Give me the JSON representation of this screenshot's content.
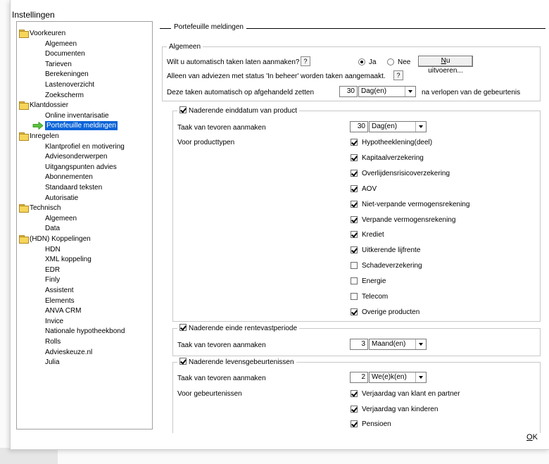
{
  "window": {
    "title": "Instellingen"
  },
  "tree": [
    {
      "label": "Voorkeuren",
      "level": 0,
      "folder": true
    },
    {
      "label": "Algemeen",
      "level": 1
    },
    {
      "label": "Documenten",
      "level": 1
    },
    {
      "label": "Tarieven",
      "level": 1
    },
    {
      "label": "Berekeningen",
      "level": 1
    },
    {
      "label": "Lastenoverzicht",
      "level": 1
    },
    {
      "label": "Zoekscherm",
      "level": 1
    },
    {
      "label": "Klantdossier",
      "level": 0,
      "folder": true
    },
    {
      "label": "Online inventarisatie",
      "level": 1
    },
    {
      "label": "Portefeuille meldingen",
      "level": 1,
      "selected": true
    },
    {
      "label": "Inregelen",
      "level": 0,
      "folder": true
    },
    {
      "label": "Klantprofiel en motivering",
      "level": 1
    },
    {
      "label": "Adviesonderwerpen",
      "level": 1
    },
    {
      "label": "Uitgangspunten advies",
      "level": 1
    },
    {
      "label": "Abonnementen",
      "level": 1
    },
    {
      "label": "Standaard teksten",
      "level": 1
    },
    {
      "label": "Autorisatie",
      "level": 1
    },
    {
      "label": "Technisch",
      "level": 0,
      "folder": true
    },
    {
      "label": "Algemeen",
      "level": 1
    },
    {
      "label": "Data",
      "level": 1
    },
    {
      "label": "(HDN) Koppelingen",
      "level": 0,
      "folder": true
    },
    {
      "label": "HDN",
      "level": 1
    },
    {
      "label": "XML koppeling",
      "level": 1
    },
    {
      "label": "EDR",
      "level": 1
    },
    {
      "label": "Finly",
      "level": 1
    },
    {
      "label": "Assistent",
      "level": 1
    },
    {
      "label": "Elements",
      "level": 1
    },
    {
      "label": "ANVA CRM",
      "level": 1
    },
    {
      "label": "Invice",
      "level": 1
    },
    {
      "label": "Nationale hypotheekbond",
      "level": 1
    },
    {
      "label": "Rolls",
      "level": 1
    },
    {
      "label": "Advieskeuze.nl",
      "level": 1
    },
    {
      "label": "Julia",
      "level": 1
    }
  ],
  "panel": {
    "title": "Portefeuille meldingen",
    "algemeen": {
      "legend": "Algemeen",
      "q1": "Wilt u automatisch taken laten aanmaken?",
      "help": "?",
      "ja": "Ja",
      "nee": "Nee",
      "selected": "Ja",
      "run_button": "Nu uitvoeren...",
      "run_button_u": "N",
      "run_button_rest": "u uitvoeren...",
      "q2": "Alleen van adviezen met status 'In beheer' worden taken aangemaakt.",
      "q3": "Deze taken automatisch op afgehandeld zetten",
      "q3_num": "30",
      "q3_unit": "Dag(en)",
      "q3_suffix": "na verlopen van de gebeurtenis"
    },
    "einddatum": {
      "legend": "Naderende einddatum van product",
      "checked": true,
      "taak_label": "Taak van tevoren aanmaken",
      "num": "30",
      "unit": "Dag(en)",
      "types_label": "Voor producttypen",
      "types": [
        {
          "label": "Hypotheeklening(deel)",
          "checked": true
        },
        {
          "label": "Kapitaalverzekering",
          "checked": true
        },
        {
          "label": "Overlijdensrisicoverzekering",
          "checked": true
        },
        {
          "label": "AOV",
          "checked": true
        },
        {
          "label": "Niet-verpande vermogensrekening",
          "checked": true
        },
        {
          "label": "Verpande vermogensrekening",
          "checked": true
        },
        {
          "label": "Krediet",
          "checked": true
        },
        {
          "label": "Uitkerende lijfrente",
          "checked": true
        },
        {
          "label": "Schadeverzekering",
          "checked": false
        },
        {
          "label": "Energie",
          "checked": false
        },
        {
          "label": "Telecom",
          "checked": false
        },
        {
          "label": "Overige producten",
          "checked": true
        }
      ]
    },
    "rentevast": {
      "legend": "Naderende einde rentevastperiode",
      "checked": true,
      "taak_label": "Taak van tevoren aanmaken",
      "num": "3",
      "unit": "Maand(en)"
    },
    "levens": {
      "legend": "Naderende levensgebeurtenissen",
      "checked": true,
      "taak_label": "Taak van tevoren aanmaken",
      "num": "2",
      "unit": "We(e)k(en)",
      "events_label": "Voor gebeurtenissen",
      "events": [
        {
          "label": "Verjaardag van klant en partner",
          "checked": true
        },
        {
          "label": "Verjaardag van kinderen",
          "checked": true
        },
        {
          "label": "Pensioen",
          "checked": true
        }
      ]
    }
  },
  "footer": {
    "ok": "OK",
    "ok_u": "O",
    "ok_rest": "K"
  }
}
